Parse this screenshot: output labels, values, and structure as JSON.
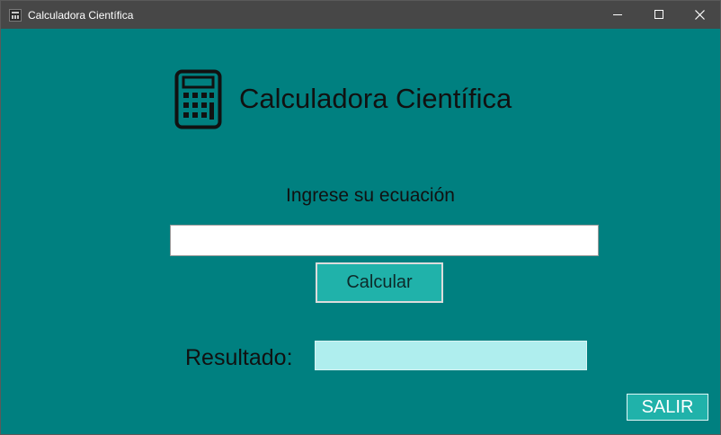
{
  "window": {
    "title": "Calculadora Científica",
    "icon": "calculator-app-icon",
    "controls": [
      "minimize-icon",
      "maximize-icon",
      "close-icon"
    ]
  },
  "header": {
    "icon": "calculator-icon",
    "title": "Calculadora Científica"
  },
  "form": {
    "prompt_label": "Ingrese su ecuación",
    "equation_value": "",
    "calculate_label": "Calcular",
    "result_label": "Resultado:",
    "result_value": ""
  },
  "footer": {
    "exit_label": "SALIR"
  },
  "colors": {
    "background": "#008080",
    "titlebar": "#474747",
    "button": "#20b2aa",
    "result_field": "#afeeee"
  }
}
